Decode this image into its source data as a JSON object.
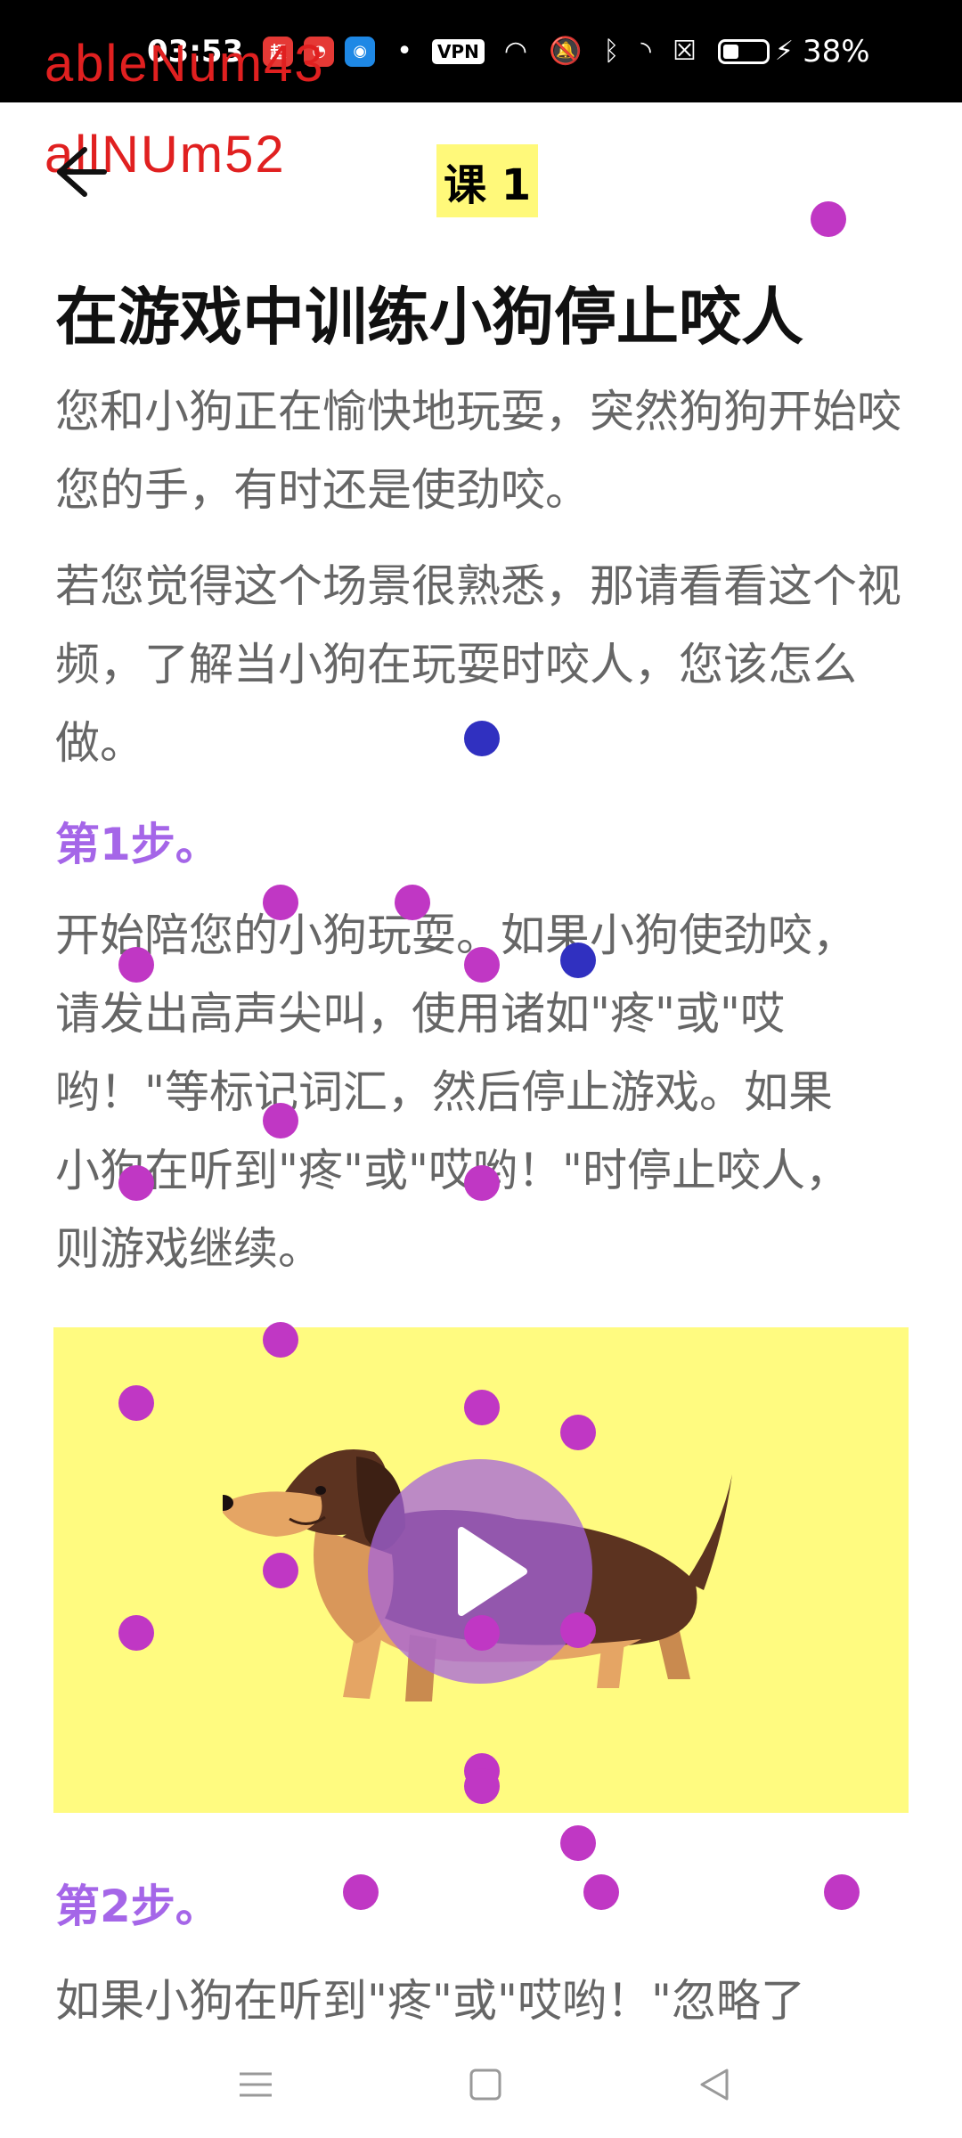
{
  "status_bar": {
    "time": "03:53",
    "vpn": "VPN",
    "battery_percent": "38%",
    "battery_level": 0.38
  },
  "debug_overlays": [
    "ableNum43",
    "allNUm52"
  ],
  "header": {
    "lesson_title": "课 1"
  },
  "article": {
    "headline": "在游戏中训练小狗停止咬人",
    "intro_1": "您和小狗正在愉快地玩耍，突然狗狗开始咬您的手，有时还是使劲咬。",
    "intro_2": "若您觉得这个场景很熟悉，那请看看这个视频，了解当小狗在玩耍时咬人，您该怎么做。",
    "step1_title": "第1步。",
    "step1_body": "开始陪您的小狗玩耍。如果小狗使劲咬，请发出高声尖叫，使用诸如\"疼\"或\"哎哟！\"等标记词汇，然后停止游戏。如果小狗在听到\"疼\"或\"哎哟！\"时停止咬人，则游戏继续。",
    "step2_title": "第2步。",
    "step2_body": "如果小狗在听到\"疼\"或\"哎哟！\"忽略了"
  },
  "colors": {
    "accent_purple": "#a566e8",
    "video_bg": "#fffb80",
    "title_highlight": "#fff97a",
    "marker_magenta": "#c037c4",
    "marker_blue": "#3030c0"
  },
  "icons": [
    "back-arrow-icon",
    "play-icon",
    "menu-icon",
    "home-icon",
    "back-triangle-icon",
    "dachshund-illustration"
  ]
}
